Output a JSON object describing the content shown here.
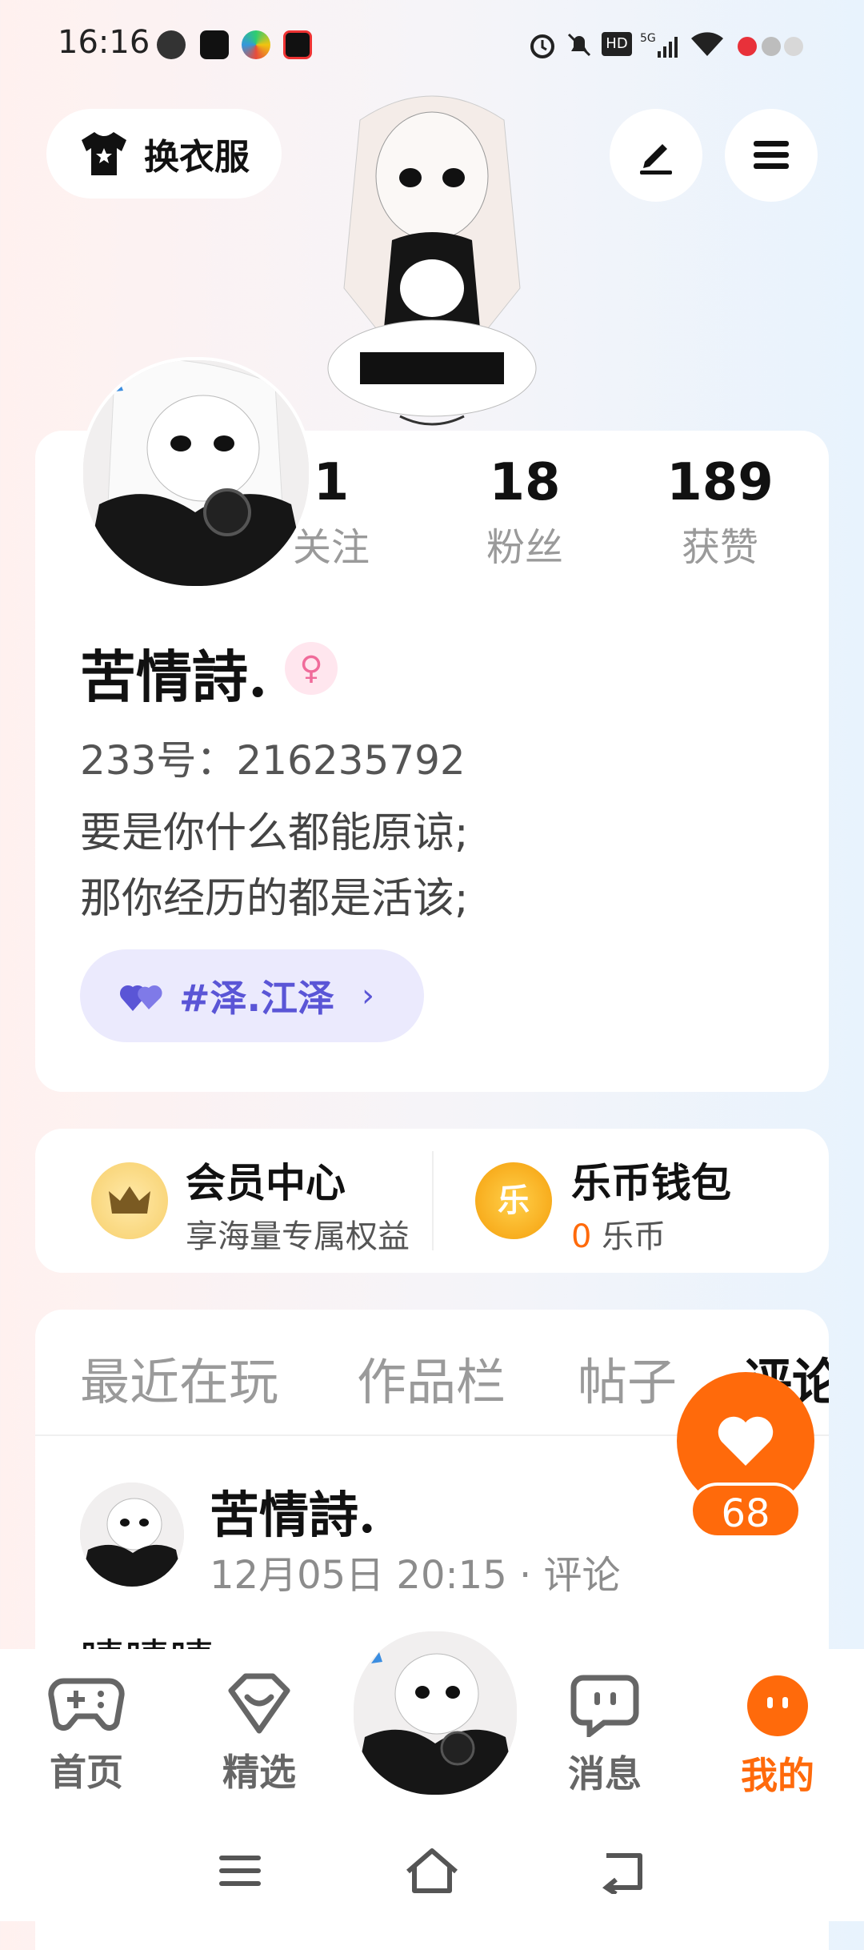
{
  "status_bar": {
    "time": "16:16",
    "right_icons": [
      "alarm-icon",
      "mute-icon",
      "hd-icon",
      "5g-signal-icon",
      "wifi-icon",
      "record-dots-icon"
    ]
  },
  "top": {
    "outfit_button": "换衣服"
  },
  "profile": {
    "stats": [
      {
        "value": "1",
        "label": "关注"
      },
      {
        "value": "18",
        "label": "粉丝"
      },
      {
        "value": "189",
        "label": "获赞"
      }
    ],
    "name": "苦情詩.",
    "uid": "233号：216235792",
    "bio_line1": "要是你什么都能原谅;",
    "bio_line2": "那你经历的都是活该;",
    "tag": "#泽.江泽",
    "tag_chevron": "›"
  },
  "member": {
    "title": "会员中心",
    "subtitle": "享海量专属权益"
  },
  "wallet": {
    "title": "乐币钱包",
    "amount": "0",
    "unit": "乐币",
    "coin_char": "乐"
  },
  "tabs": [
    "最近在玩",
    "作品栏",
    "帖子",
    "评论"
  ],
  "comment": {
    "author": "苦情詩.",
    "meta": "12月05日 20:15 · 评论",
    "text": "啧啧啧"
  },
  "like": {
    "count": "68"
  },
  "bottom_nav": [
    {
      "label": "首页"
    },
    {
      "label": "精选"
    },
    {
      "label": "消息"
    },
    {
      "label": "我的"
    }
  ],
  "colors": {
    "accent": "#ff6a0b",
    "tag_bg": "#ebeafd",
    "tag_text": "#5a55d6"
  }
}
